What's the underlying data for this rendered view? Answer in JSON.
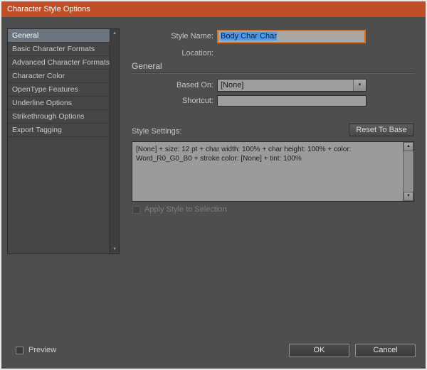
{
  "window": {
    "title": "Character Style Options"
  },
  "sidebar": {
    "items": [
      {
        "label": "General",
        "selected": true
      },
      {
        "label": "Basic Character Formats",
        "selected": false
      },
      {
        "label": "Advanced Character Formats",
        "selected": false
      },
      {
        "label": "Character Color",
        "selected": false
      },
      {
        "label": "OpenType Features",
        "selected": false
      },
      {
        "label": "Underline Options",
        "selected": false
      },
      {
        "label": "Strikethrough Options",
        "selected": false
      },
      {
        "label": "Export Tagging",
        "selected": false
      }
    ]
  },
  "form": {
    "style_name_label": "Style Name:",
    "style_name_value": "Body Char Char",
    "location_label": "Location:",
    "section_heading": "General",
    "based_on_label": "Based On:",
    "based_on_value": "[None]",
    "shortcut_label": "Shortcut:",
    "shortcut_value": "",
    "style_settings_label": "Style Settings:",
    "reset_to_base_label": "Reset To Base",
    "style_settings_text": "[None] + size: 12 pt + char width: 100% + char height: 100% + color: Word_R0_G0_B0 + stroke color: [None] + tint: 100%",
    "apply_style_label": "Apply Style to Selection",
    "apply_style_checked": false
  },
  "footer": {
    "preview_label": "Preview",
    "preview_checked": false,
    "ok_label": "OK",
    "cancel_label": "Cancel"
  },
  "icons": {
    "dropdown_arrow": "▼",
    "scroll_up_arrow": "▲",
    "scroll_down_arrow": "▼"
  },
  "colors": {
    "titlebar_bg": "#BE4E28",
    "dialog_bg": "#4E4E4E",
    "selected_item_bg": "#6C7480",
    "text_selection_bg": "#4D9BE8",
    "focus_ring": "#D4722C"
  }
}
